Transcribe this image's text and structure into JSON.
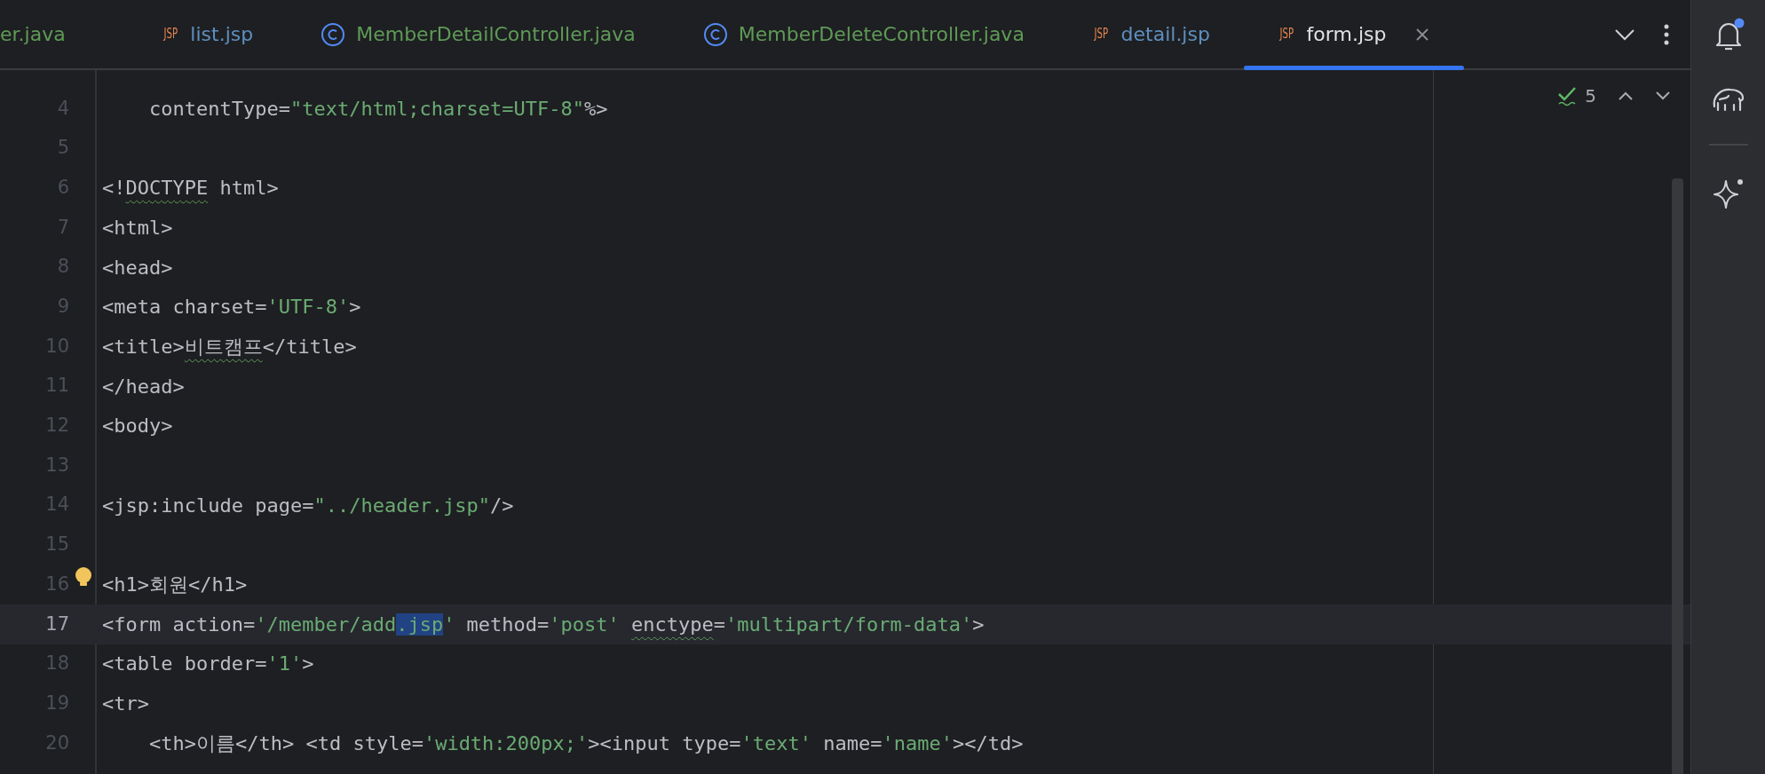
{
  "tabs": [
    {
      "label": "er.java",
      "kind": "java",
      "color": "#5f9a57",
      "selected": false
    },
    {
      "label": "list.jsp",
      "kind": "jsp",
      "badge": "JSP",
      "color": "#5d8fbf",
      "selected": false
    },
    {
      "label": "MemberDetailController.java",
      "kind": "java",
      "color": "#5f9a57",
      "selected": false
    },
    {
      "label": "MemberDeleteController.java",
      "kind": "java",
      "color": "#5f9a57",
      "selected": false
    },
    {
      "label": "detail.jsp",
      "kind": "jsp",
      "badge": "JSP",
      "color": "#5d8fbf",
      "selected": false
    },
    {
      "label": "form.jsp",
      "kind": "jsp",
      "badge": "JSP",
      "color": "#dfe1e5",
      "selected": true
    }
  ],
  "inspections": {
    "count": "5"
  },
  "lines": [
    {
      "number": "4",
      "current": false,
      "bulb": false,
      "segments": [
        {
          "kind": "plain",
          "text": "    contentType="
        },
        {
          "kind": "string",
          "text": "\"text/html;charset=UTF-8\""
        },
        {
          "kind": "plain",
          "text": "%>"
        }
      ]
    },
    {
      "number": "5",
      "current": false,
      "bulb": false
    },
    {
      "number": "6",
      "current": false,
      "bulb": false,
      "segments": [
        {
          "kind": "plain",
          "text": "<!"
        },
        {
          "kind": "typo",
          "text": "DOCTYPE"
        },
        {
          "kind": "plain",
          "text": " html>"
        }
      ]
    },
    {
      "number": "7",
      "current": false,
      "bulb": false,
      "segments": [
        {
          "kind": "plain",
          "text": "<html>"
        }
      ]
    },
    {
      "number": "8",
      "current": false,
      "bulb": false,
      "segments": [
        {
          "kind": "plain",
          "text": "<head>"
        }
      ]
    },
    {
      "number": "9",
      "current": false,
      "bulb": false,
      "segments": [
        {
          "kind": "plain",
          "text": "<meta charset="
        },
        {
          "kind": "string",
          "text": "'UTF-8'"
        },
        {
          "kind": "plain",
          "text": ">"
        }
      ]
    },
    {
      "number": "10",
      "current": false,
      "bulb": false,
      "segments": [
        {
          "kind": "plain",
          "text": "<title>"
        },
        {
          "kind": "typo",
          "text": "비트캠프"
        },
        {
          "kind": "plain",
          "text": "</title>"
        }
      ]
    },
    {
      "number": "11",
      "current": false,
      "bulb": false,
      "segments": [
        {
          "kind": "plain",
          "text": "</head>"
        }
      ]
    },
    {
      "number": "12",
      "current": false,
      "bulb": false,
      "segments": [
        {
          "kind": "plain",
          "text": "<body>"
        }
      ]
    },
    {
      "number": "13",
      "current": false,
      "bulb": false
    },
    {
      "number": "14",
      "current": false,
      "bulb": false,
      "segments": [
        {
          "kind": "plain",
          "text": "<jsp:include page="
        },
        {
          "kind": "string",
          "text": "\"../header.jsp\""
        },
        {
          "kind": "plain",
          "text": "/>"
        }
      ]
    },
    {
      "number": "15",
      "current": false,
      "bulb": false
    },
    {
      "number": "16",
      "current": false,
      "bulb": true,
      "segments": [
        {
          "kind": "plain",
          "text": "<h1>회원</h1>"
        }
      ]
    },
    {
      "number": "17",
      "current": true,
      "bulb": false,
      "segments": [
        {
          "kind": "plain",
          "text": "<form action="
        },
        {
          "kind": "string",
          "text": "'/member/add"
        },
        {
          "kind": "selected",
          "text": ".jsp"
        },
        {
          "kind": "string",
          "text": "'"
        },
        {
          "kind": "plain",
          "text": " method="
        },
        {
          "kind": "string",
          "text": "'post' "
        },
        {
          "kind": "typo",
          "text": "enctype"
        },
        {
          "kind": "plain",
          "text": "="
        },
        {
          "kind": "string",
          "text": "'multipart/form-data'"
        },
        {
          "kind": "plain",
          "text": ">"
        }
      ]
    },
    {
      "number": "18",
      "current": false,
      "bulb": false,
      "segments": [
        {
          "kind": "plain",
          "text": "<table border="
        },
        {
          "kind": "string",
          "text": "'1'"
        },
        {
          "kind": "plain",
          "text": ">"
        }
      ]
    },
    {
      "number": "19",
      "current": false,
      "bulb": false,
      "segments": [
        {
          "kind": "plain",
          "text": "<tr>"
        }
      ]
    },
    {
      "number": "20",
      "current": false,
      "bulb": false,
      "segments": [
        {
          "kind": "plain",
          "text": "    <th>이름</th> <td style="
        },
        {
          "kind": "string",
          "text": "'width:200px;'"
        },
        {
          "kind": "plain",
          "text": "><input type="
        },
        {
          "kind": "string",
          "text": "'text'"
        },
        {
          "kind": "plain",
          "text": " name="
        },
        {
          "kind": "string",
          "text": "'name'"
        },
        {
          "kind": "plain",
          "text": "></td>"
        }
      ]
    }
  ]
}
